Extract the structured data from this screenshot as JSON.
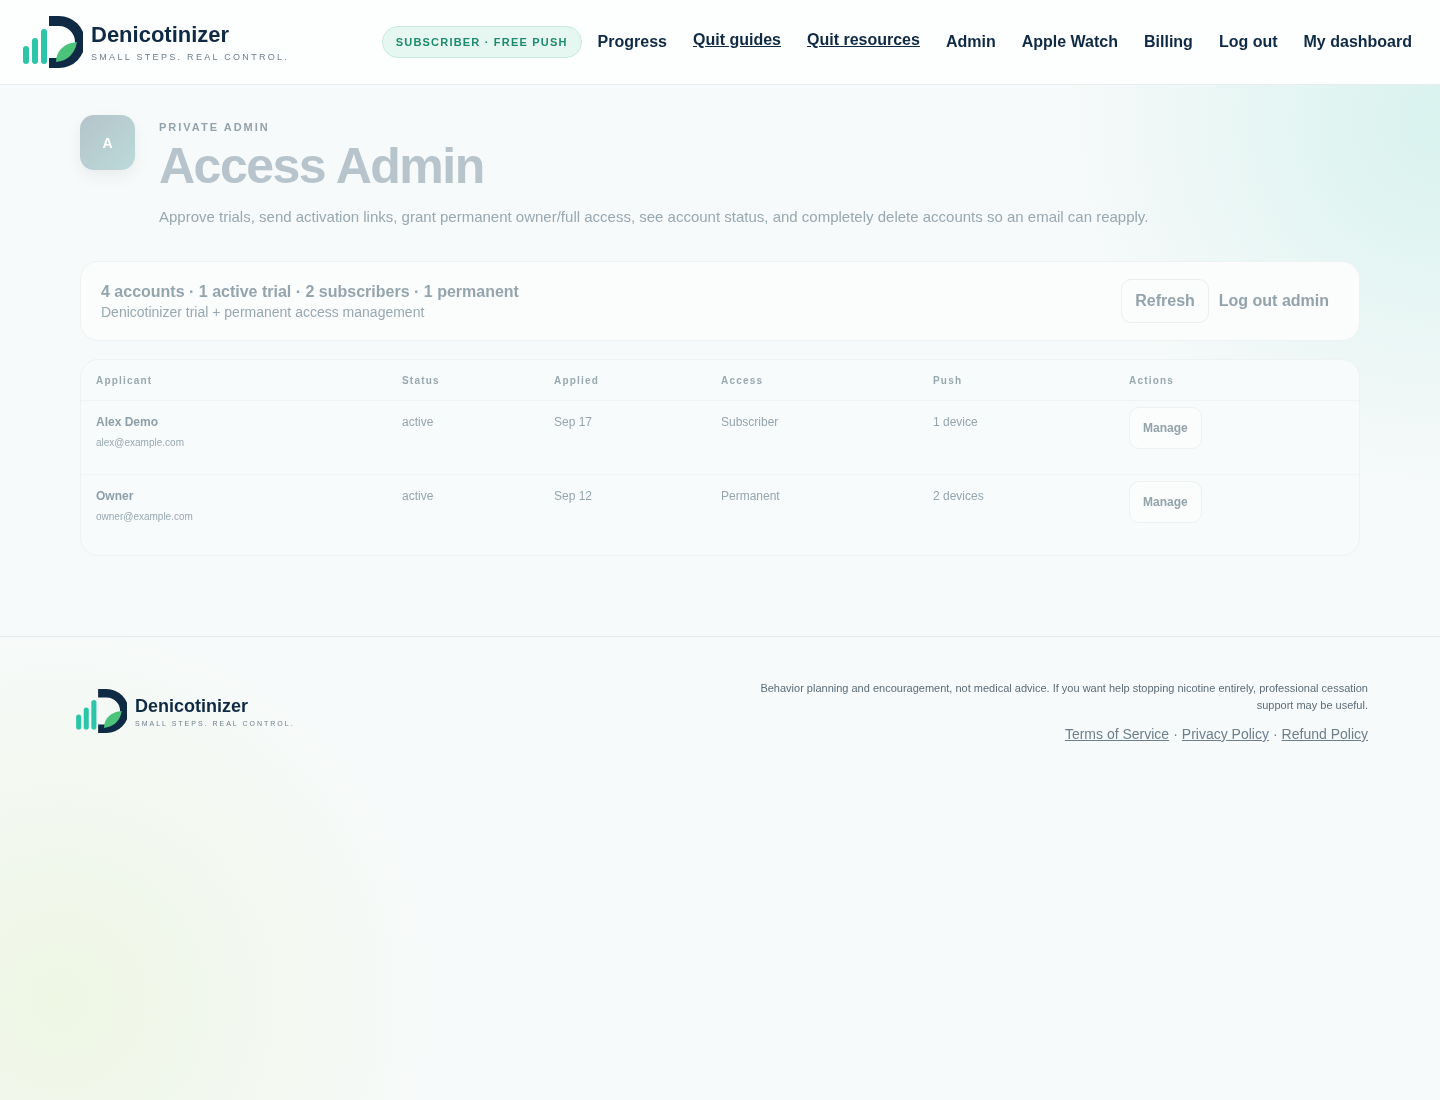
{
  "header": {
    "brand": {
      "name": "Denicotinizer",
      "tagline": "SMALL STEPS. REAL CONTROL."
    },
    "plan_badge": "SUBSCRIBER · FREE PUSH",
    "nav": [
      {
        "label": "Progress",
        "underlined": false
      },
      {
        "label": "Quit guides",
        "underlined": true
      },
      {
        "label": "Quit resources",
        "underlined": true
      },
      {
        "label": "Admin",
        "underlined": false
      },
      {
        "label": "Apple Watch",
        "underlined": false
      },
      {
        "label": "Billing",
        "underlined": false
      },
      {
        "label": "Log out",
        "underlined": false
      },
      {
        "label": "My dashboard",
        "underlined": false
      }
    ]
  },
  "hero": {
    "avatar": "A",
    "eyebrow": "PRIVATE ADMIN",
    "title": "Access Admin",
    "description": "Approve trials, send activation links, grant permanent owner/full access, see account status, and completely delete accounts so an email can reapply."
  },
  "summary": {
    "counts": "4 accounts · 1 active trial · 2 subscribers · 1 permanent",
    "subtitle": "Denicotinizer trial + permanent access management",
    "buttons": [
      "Refresh",
      "Log out admin"
    ]
  },
  "table": {
    "columns": [
      "Applicant",
      "Status",
      "Applied",
      "Access",
      "Push",
      "Actions"
    ],
    "rows": [
      {
        "name": "Alex Demo",
        "email": "alex@example.com",
        "status": "active",
        "applied": "Sep 17",
        "access": "Subscriber",
        "push": "1 device",
        "action": "Manage"
      },
      {
        "name": "Owner",
        "email": "owner@example.com",
        "status": "active",
        "applied": "Sep 12",
        "access": "Permanent",
        "push": "2 devices",
        "action": "Manage"
      }
    ]
  },
  "footer": {
    "brand": {
      "name": "Denicotinizer",
      "tagline": "SMALL STEPS. REAL CONTROL."
    },
    "disclaimer": "Behavior planning and encouragement, not medical advice. If you want help stopping nicotine entirely, professional cessation support may be useful.",
    "links": [
      "Terms of Service",
      "Privacy Policy",
      "Refund Policy"
    ],
    "separator": "·"
  }
}
